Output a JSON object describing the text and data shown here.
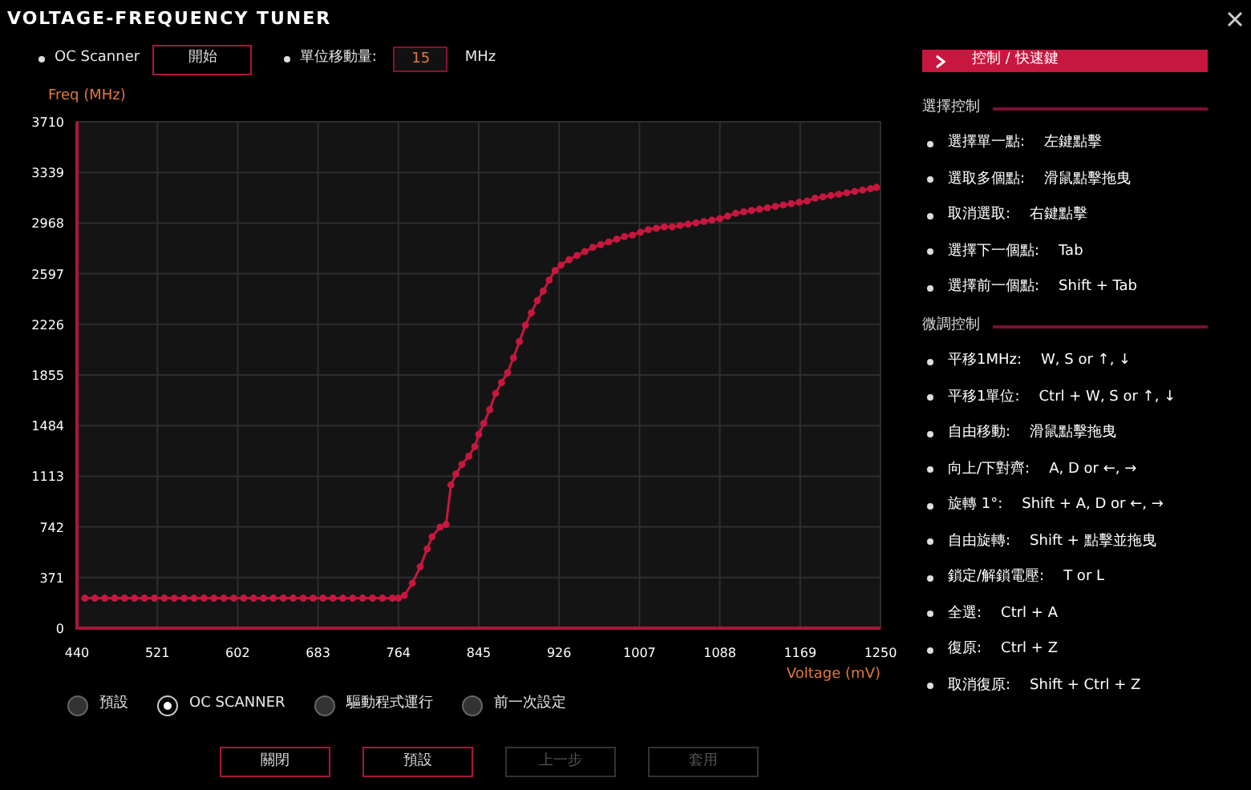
{
  "window": {
    "title": "VOLTAGE-FREQUENCY TUNER"
  },
  "scanner": {
    "label": "OC Scanner",
    "button": "開始"
  },
  "step": {
    "label": "單位移動量:",
    "value": "15",
    "unit": "MHz"
  },
  "chart_data": {
    "type": "line",
    "ylabel": "Freq (MHz)",
    "xlabel": "Voltage (mV)",
    "xlim": [
      440,
      1250
    ],
    "ylim": [
      0,
      3710
    ],
    "xticks": [
      440,
      521,
      602,
      683,
      764,
      845,
      926,
      1007,
      1088,
      1169,
      1250
    ],
    "yticks": [
      0,
      371,
      742,
      1113,
      1484,
      1855,
      2226,
      2597,
      2968,
      3339,
      3710
    ],
    "x": [
      448,
      458,
      468,
      478,
      488,
      498,
      508,
      518,
      528,
      538,
      548,
      558,
      568,
      578,
      588,
      598,
      608,
      618,
      628,
      638,
      648,
      658,
      668,
      678,
      688,
      698,
      708,
      718,
      728,
      738,
      748,
      758,
      764,
      770,
      778,
      786,
      793,
      798,
      806,
      812,
      817,
      822,
      828,
      835,
      841,
      845,
      850,
      856,
      862,
      868,
      874,
      880,
      886,
      892,
      898,
      904,
      910,
      916,
      922,
      928,
      936,
      944,
      952,
      960,
      968,
      976,
      984,
      992,
      1000,
      1008,
      1016,
      1024,
      1032,
      1040,
      1048,
      1056,
      1064,
      1072,
      1080,
      1088,
      1096,
      1104,
      1112,
      1120,
      1128,
      1136,
      1144,
      1152,
      1160,
      1168,
      1176,
      1184,
      1192,
      1200,
      1208,
      1216,
      1224,
      1232,
      1240,
      1246
    ],
    "grid": true,
    "series": [
      {
        "color": "#c8173f",
        "marker": true,
        "values": [
          220,
          220,
          220,
          220,
          220,
          220,
          220,
          220,
          220,
          220,
          220,
          220,
          220,
          220,
          220,
          220,
          220,
          220,
          220,
          220,
          220,
          220,
          220,
          220,
          220,
          220,
          220,
          220,
          220,
          220,
          220,
          220,
          220,
          240,
          330,
          450,
          580,
          670,
          740,
          760,
          1050,
          1130,
          1200,
          1260,
          1330,
          1420,
          1500,
          1600,
          1720,
          1800,
          1870,
          1980,
          2100,
          2220,
          2310,
          2400,
          2470,
          2550,
          2620,
          2660,
          2700,
          2730,
          2760,
          2790,
          2810,
          2830,
          2850,
          2870,
          2880,
          2900,
          2920,
          2930,
          2940,
          2940,
          2950,
          2960,
          2970,
          2980,
          2990,
          3000,
          3020,
          3040,
          3050,
          3060,
          3070,
          3080,
          3090,
          3100,
          3110,
          3120,
          3130,
          3150,
          3160,
          3170,
          3180,
          3190,
          3200,
          3210,
          3220,
          3230
        ]
      }
    ]
  },
  "modes": [
    {
      "label": "預設",
      "selected": false
    },
    {
      "label": "OC SCANNER",
      "selected": true
    },
    {
      "label": "驅動程式運行",
      "selected": false
    },
    {
      "label": "前一次設定",
      "selected": false
    }
  ],
  "buttons": [
    {
      "label": "關閉",
      "disabled": false
    },
    {
      "label": "預設",
      "disabled": false
    },
    {
      "label": "上一步",
      "disabled": true
    },
    {
      "label": "套用",
      "disabled": true
    }
  ],
  "panel": {
    "header": "控制 / 快速鍵",
    "sections": [
      {
        "title": "選擇控制",
        "items": [
          {
            "action": "選擇單一點:",
            "keys": "左鍵點擊"
          },
          {
            "action": "選取多個點:",
            "keys": "滑鼠點擊拖曳"
          },
          {
            "action": "取消選取:",
            "keys": "右鍵點擊"
          },
          {
            "action": "選擇下一個點:",
            "keys": "Tab"
          },
          {
            "action": "選擇前一個點:",
            "keys": "Shift + Tab"
          }
        ]
      },
      {
        "title": "微調控制",
        "items": [
          {
            "action": "平移1MHz:",
            "keys": "W, S or ↑, ↓"
          },
          {
            "action": "平移1單位:",
            "keys": "Ctrl + W, S or ↑, ↓"
          },
          {
            "action": "自由移動:",
            "keys": "滑鼠點擊拖曳"
          },
          {
            "action": "向上/下對齊:",
            "keys": "A, D or ←, →"
          },
          {
            "action": "旋轉 1°:",
            "keys": "Shift + A, D or ←, →"
          },
          {
            "action": "自由旋轉:",
            "keys": "Shift + 點擊並拖曳"
          },
          {
            "action": "鎖定/解鎖電壓:",
            "keys": "T or L"
          },
          {
            "action": "全選:",
            "keys": "Ctrl + A"
          },
          {
            "action": "復原:",
            "keys": "Ctrl + Z"
          },
          {
            "action": "取消復原:",
            "keys": "Shift + Ctrl + Z"
          }
        ]
      }
    ]
  }
}
